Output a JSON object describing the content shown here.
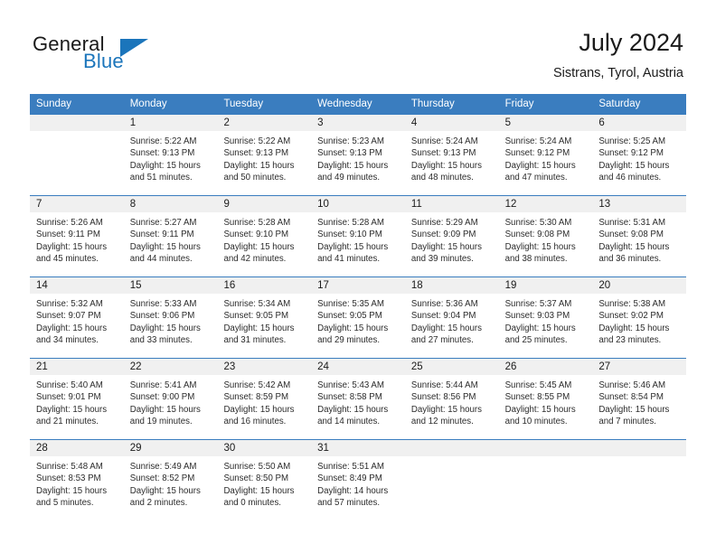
{
  "brand": {
    "name_part1": "General",
    "name_part2": "Blue",
    "accent_color": "#1b75bb"
  },
  "header": {
    "title": "July 2024",
    "location": "Sistrans, Tyrol, Austria"
  },
  "theme": {
    "header_row_color": "#3a7dbf",
    "day_band_color": "#f0f0f0",
    "text_color": "#1a1a1a"
  },
  "weekdays": [
    "Sunday",
    "Monday",
    "Tuesday",
    "Wednesday",
    "Thursday",
    "Friday",
    "Saturday"
  ],
  "labels": {
    "sunrise_prefix": "Sunrise:",
    "sunset_prefix": "Sunset:",
    "daylight_prefix": "Daylight:"
  },
  "weeks": [
    [
      {
        "day": "",
        "sunrise": "",
        "sunset": "",
        "daylight_line1": "",
        "daylight_line2": ""
      },
      {
        "day": "1",
        "sunrise": "Sunrise: 5:22 AM",
        "sunset": "Sunset: 9:13 PM",
        "daylight_line1": "Daylight: 15 hours",
        "daylight_line2": "and 51 minutes."
      },
      {
        "day": "2",
        "sunrise": "Sunrise: 5:22 AM",
        "sunset": "Sunset: 9:13 PM",
        "daylight_line1": "Daylight: 15 hours",
        "daylight_line2": "and 50 minutes."
      },
      {
        "day": "3",
        "sunrise": "Sunrise: 5:23 AM",
        "sunset": "Sunset: 9:13 PM",
        "daylight_line1": "Daylight: 15 hours",
        "daylight_line2": "and 49 minutes."
      },
      {
        "day": "4",
        "sunrise": "Sunrise: 5:24 AM",
        "sunset": "Sunset: 9:13 PM",
        "daylight_line1": "Daylight: 15 hours",
        "daylight_line2": "and 48 minutes."
      },
      {
        "day": "5",
        "sunrise": "Sunrise: 5:24 AM",
        "sunset": "Sunset: 9:12 PM",
        "daylight_line1": "Daylight: 15 hours",
        "daylight_line2": "and 47 minutes."
      },
      {
        "day": "6",
        "sunrise": "Sunrise: 5:25 AM",
        "sunset": "Sunset: 9:12 PM",
        "daylight_line1": "Daylight: 15 hours",
        "daylight_line2": "and 46 minutes."
      }
    ],
    [
      {
        "day": "7",
        "sunrise": "Sunrise: 5:26 AM",
        "sunset": "Sunset: 9:11 PM",
        "daylight_line1": "Daylight: 15 hours",
        "daylight_line2": "and 45 minutes."
      },
      {
        "day": "8",
        "sunrise": "Sunrise: 5:27 AM",
        "sunset": "Sunset: 9:11 PM",
        "daylight_line1": "Daylight: 15 hours",
        "daylight_line2": "and 44 minutes."
      },
      {
        "day": "9",
        "sunrise": "Sunrise: 5:28 AM",
        "sunset": "Sunset: 9:10 PM",
        "daylight_line1": "Daylight: 15 hours",
        "daylight_line2": "and 42 minutes."
      },
      {
        "day": "10",
        "sunrise": "Sunrise: 5:28 AM",
        "sunset": "Sunset: 9:10 PM",
        "daylight_line1": "Daylight: 15 hours",
        "daylight_line2": "and 41 minutes."
      },
      {
        "day": "11",
        "sunrise": "Sunrise: 5:29 AM",
        "sunset": "Sunset: 9:09 PM",
        "daylight_line1": "Daylight: 15 hours",
        "daylight_line2": "and 39 minutes."
      },
      {
        "day": "12",
        "sunrise": "Sunrise: 5:30 AM",
        "sunset": "Sunset: 9:08 PM",
        "daylight_line1": "Daylight: 15 hours",
        "daylight_line2": "and 38 minutes."
      },
      {
        "day": "13",
        "sunrise": "Sunrise: 5:31 AM",
        "sunset": "Sunset: 9:08 PM",
        "daylight_line1": "Daylight: 15 hours",
        "daylight_line2": "and 36 minutes."
      }
    ],
    [
      {
        "day": "14",
        "sunrise": "Sunrise: 5:32 AM",
        "sunset": "Sunset: 9:07 PM",
        "daylight_line1": "Daylight: 15 hours",
        "daylight_line2": "and 34 minutes."
      },
      {
        "day": "15",
        "sunrise": "Sunrise: 5:33 AM",
        "sunset": "Sunset: 9:06 PM",
        "daylight_line1": "Daylight: 15 hours",
        "daylight_line2": "and 33 minutes."
      },
      {
        "day": "16",
        "sunrise": "Sunrise: 5:34 AM",
        "sunset": "Sunset: 9:05 PM",
        "daylight_line1": "Daylight: 15 hours",
        "daylight_line2": "and 31 minutes."
      },
      {
        "day": "17",
        "sunrise": "Sunrise: 5:35 AM",
        "sunset": "Sunset: 9:05 PM",
        "daylight_line1": "Daylight: 15 hours",
        "daylight_line2": "and 29 minutes."
      },
      {
        "day": "18",
        "sunrise": "Sunrise: 5:36 AM",
        "sunset": "Sunset: 9:04 PM",
        "daylight_line1": "Daylight: 15 hours",
        "daylight_line2": "and 27 minutes."
      },
      {
        "day": "19",
        "sunrise": "Sunrise: 5:37 AM",
        "sunset": "Sunset: 9:03 PM",
        "daylight_line1": "Daylight: 15 hours",
        "daylight_line2": "and 25 minutes."
      },
      {
        "day": "20",
        "sunrise": "Sunrise: 5:38 AM",
        "sunset": "Sunset: 9:02 PM",
        "daylight_line1": "Daylight: 15 hours",
        "daylight_line2": "and 23 minutes."
      }
    ],
    [
      {
        "day": "21",
        "sunrise": "Sunrise: 5:40 AM",
        "sunset": "Sunset: 9:01 PM",
        "daylight_line1": "Daylight: 15 hours",
        "daylight_line2": "and 21 minutes."
      },
      {
        "day": "22",
        "sunrise": "Sunrise: 5:41 AM",
        "sunset": "Sunset: 9:00 PM",
        "daylight_line1": "Daylight: 15 hours",
        "daylight_line2": "and 19 minutes."
      },
      {
        "day": "23",
        "sunrise": "Sunrise: 5:42 AM",
        "sunset": "Sunset: 8:59 PM",
        "daylight_line1": "Daylight: 15 hours",
        "daylight_line2": "and 16 minutes."
      },
      {
        "day": "24",
        "sunrise": "Sunrise: 5:43 AM",
        "sunset": "Sunset: 8:58 PM",
        "daylight_line1": "Daylight: 15 hours",
        "daylight_line2": "and 14 minutes."
      },
      {
        "day": "25",
        "sunrise": "Sunrise: 5:44 AM",
        "sunset": "Sunset: 8:56 PM",
        "daylight_line1": "Daylight: 15 hours",
        "daylight_line2": "and 12 minutes."
      },
      {
        "day": "26",
        "sunrise": "Sunrise: 5:45 AM",
        "sunset": "Sunset: 8:55 PM",
        "daylight_line1": "Daylight: 15 hours",
        "daylight_line2": "and 10 minutes."
      },
      {
        "day": "27",
        "sunrise": "Sunrise: 5:46 AM",
        "sunset": "Sunset: 8:54 PM",
        "daylight_line1": "Daylight: 15 hours",
        "daylight_line2": "and 7 minutes."
      }
    ],
    [
      {
        "day": "28",
        "sunrise": "Sunrise: 5:48 AM",
        "sunset": "Sunset: 8:53 PM",
        "daylight_line1": "Daylight: 15 hours",
        "daylight_line2": "and 5 minutes."
      },
      {
        "day": "29",
        "sunrise": "Sunrise: 5:49 AM",
        "sunset": "Sunset: 8:52 PM",
        "daylight_line1": "Daylight: 15 hours",
        "daylight_line2": "and 2 minutes."
      },
      {
        "day": "30",
        "sunrise": "Sunrise: 5:50 AM",
        "sunset": "Sunset: 8:50 PM",
        "daylight_line1": "Daylight: 15 hours",
        "daylight_line2": "and 0 minutes."
      },
      {
        "day": "31",
        "sunrise": "Sunrise: 5:51 AM",
        "sunset": "Sunset: 8:49 PM",
        "daylight_line1": "Daylight: 14 hours",
        "daylight_line2": "and 57 minutes."
      },
      {
        "day": "",
        "sunrise": "",
        "sunset": "",
        "daylight_line1": "",
        "daylight_line2": ""
      },
      {
        "day": "",
        "sunrise": "",
        "sunset": "",
        "daylight_line1": "",
        "daylight_line2": ""
      },
      {
        "day": "",
        "sunrise": "",
        "sunset": "",
        "daylight_line1": "",
        "daylight_line2": ""
      }
    ]
  ]
}
